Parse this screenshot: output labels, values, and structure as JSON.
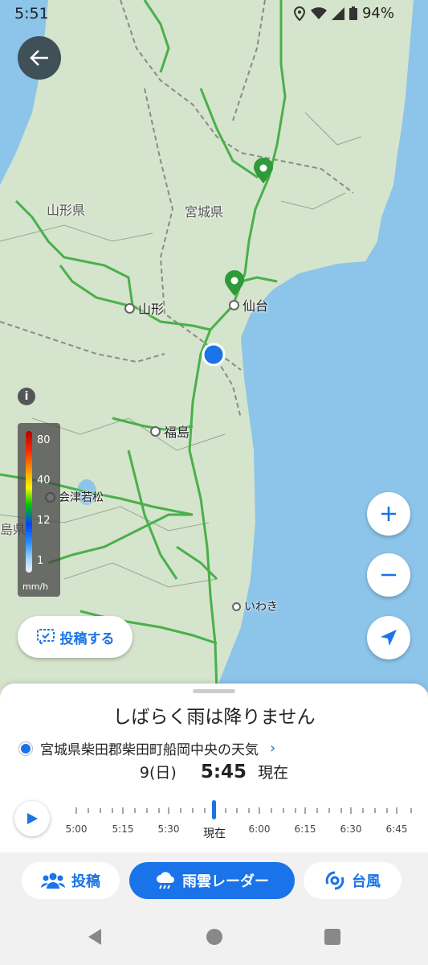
{
  "status": {
    "time": "5:51",
    "battery": "94%"
  },
  "prefectures": [
    {
      "id": "yamagata-pref",
      "label": "山形県"
    },
    {
      "id": "miyagi-pref",
      "label": "宮城県"
    },
    {
      "id": "fukushima-pref-partial",
      "label": "島県"
    }
  ],
  "cities": [
    {
      "id": "yamagata",
      "label": "山形"
    },
    {
      "id": "sendai",
      "label": "仙台"
    },
    {
      "id": "fukushima",
      "label": "福島"
    },
    {
      "id": "aizuwakamatsu",
      "label": "会津若松"
    },
    {
      "id": "iwaki",
      "label": "いわき"
    }
  ],
  "legend": {
    "ticks": [
      "80",
      "40",
      "12",
      "1"
    ],
    "unit": "mm/h"
  },
  "post_button": {
    "label": "投稿する"
  },
  "sheet": {
    "headline": "しばらく雨は降りません",
    "location": "宮城県柴田郡柴田町船岡中央の天気",
    "day": "9(日)",
    "time": "5:45",
    "now": "現在",
    "timeline_labels": [
      "5:00",
      "5:15",
      "5:30",
      "現在",
      "6:00",
      "6:15",
      "6:30",
      "6:45"
    ]
  },
  "tabs": [
    {
      "label": "投稿",
      "icon": "people-icon"
    },
    {
      "label": "雨雲レーダー",
      "icon": "rain-cloud-icon"
    },
    {
      "label": "台風",
      "icon": "typhoon-icon"
    }
  ],
  "colors": {
    "accent": "#1a73e8",
    "sea": "#8cc4ea",
    "land": "#d5e4cc",
    "roads": "#49b04b"
  }
}
